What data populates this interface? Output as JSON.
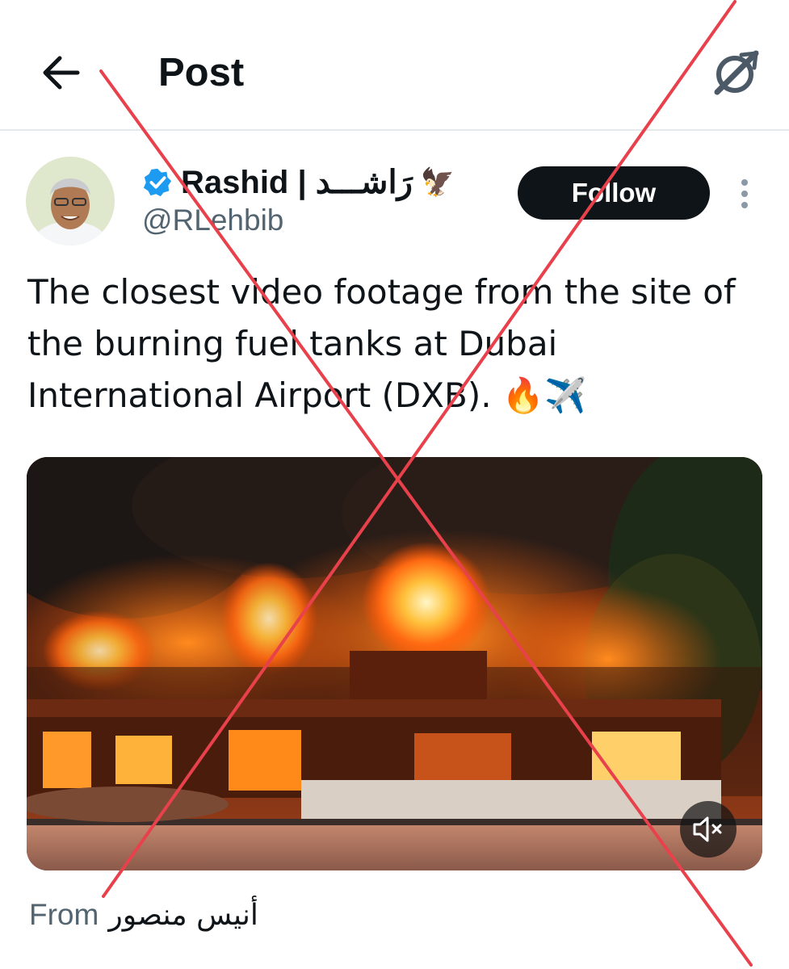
{
  "header": {
    "title": "Post",
    "back_icon": "arrow-left-icon",
    "right_icon": "grok-icon"
  },
  "author": {
    "display_name": "Rashid | رَاشـــد",
    "name_emoji": "🦅",
    "handle": "@RLehbib",
    "verified": true,
    "verified_color": "#1d9bf0",
    "avatar_icon": "profile-photo"
  },
  "follow_label": "Follow",
  "more_icon": "more-vertical-icon",
  "tweet_text": "The closest video footage from the site of the burning fuel tanks at Dubai International Airport (DXB). 🔥✈️",
  "media": {
    "type": "video",
    "subject": "burning-building-video",
    "mute_icon": "volume-muted-icon"
  },
  "source": {
    "prefix": "From",
    "author": "أنيس منصور"
  },
  "overlay": {
    "type": "red-x-cross",
    "color": "#e8414b"
  },
  "colors": {
    "text_primary": "#0f1419",
    "text_secondary": "#536471",
    "follow_bg": "#0f1419",
    "divider": "#e6e9ec"
  }
}
